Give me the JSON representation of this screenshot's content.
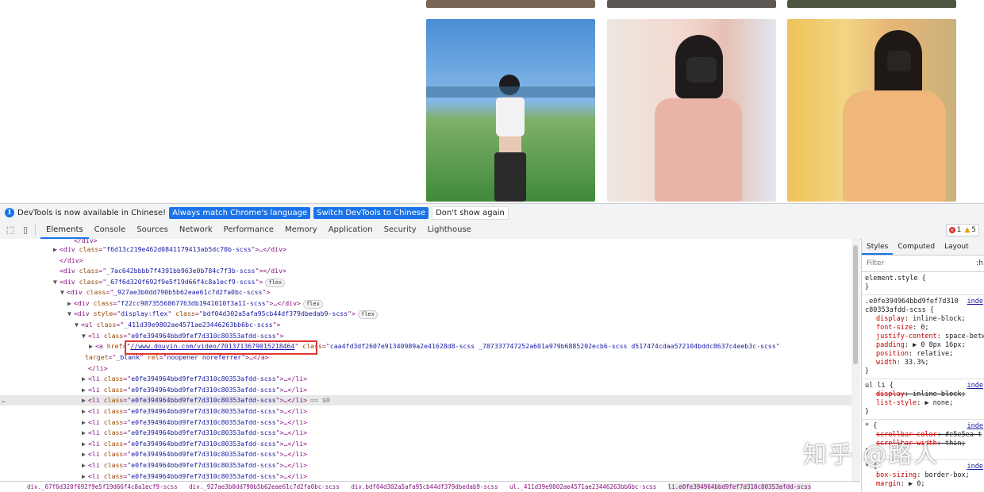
{
  "infobar": {
    "message": "DevTools is now available in Chinese!",
    "btn_match": "Always match Chrome's language",
    "btn_switch": "Switch DevTools to Chinese",
    "btn_dismiss": "Don't show again"
  },
  "tabs": [
    "Elements",
    "Console",
    "Sources",
    "Network",
    "Performance",
    "Memory",
    "Application",
    "Security",
    "Lighthouse"
  ],
  "issues": {
    "errors": "1",
    "warnings": "5"
  },
  "dom_lines": [
    {
      "indent": 0,
      "tri": "",
      "html": "</div>"
    },
    {
      "indent": 1,
      "tri": "▶",
      "tag_open": "<div ",
      "attr": "class",
      "val": "f6d13c219e462d0841179413ab5dc70b-scss",
      "tail": ">…</div>"
    },
    {
      "indent": 1,
      "tri": "",
      "tag_open": "</div>",
      "attr": "",
      "val": "",
      "tail": ""
    },
    {
      "indent": 1,
      "tri": "",
      "tag_open": "<div ",
      "attr": "class",
      "val": "_7ac642bbbb7f4391bb963e0b784c7f3b-scss",
      "tail": "></div>"
    },
    {
      "indent": 1,
      "tri": "▼",
      "tag_open": "<div ",
      "attr": "class",
      "val": "_67f6d320f692f9e5f19d66f4c8a1ecf9-scss",
      "tail": ">",
      "pill": "flex"
    },
    {
      "indent": 2,
      "tri": "▼",
      "tag_open": "<div ",
      "attr": "class",
      "val": "_927ae3b0dd790b5b62eae61c7d2fa0bc-scss",
      "tail": ">"
    },
    {
      "indent": 3,
      "tri": "▶",
      "tag_open": "<div ",
      "attr": "class",
      "val": "f22cc9873556867763db1941010f3a11-scss",
      "tail": ">…</div>",
      "pill": "flex"
    },
    {
      "indent": 3,
      "tri": "▼",
      "tag_open": "<div ",
      "attr": "style",
      "val": "display:flex",
      "attr2": "class",
      "val2": "bdf04d302a5afa95cb44df379dbedab9-scss",
      "tail": ">",
      "pill": "flex"
    },
    {
      "indent": 4,
      "tri": "▼",
      "tag_open": "<ul ",
      "attr": "class",
      "val": "_411d39e9802ae4571ae23446263bb6bc-scss",
      "tail": ">"
    },
    {
      "indent": 5,
      "tri": "▼",
      "tag_open": "<li ",
      "attr": "class",
      "val": "e0fe394964bbd9fef7d310c80353afdd-scss",
      "tail": ">"
    },
    {
      "indent": 6,
      "tri": "▶",
      "tag_open": "<a ",
      "attr": "href",
      "val": "//www.douyin.com/video/7013713679015218464",
      "attr2": "class",
      "val2": "caa4fd3df2607e91340989a2e41628d8-scss _787337747252a601a979b6885202ecb6-scss d517474cdaa572104bddc8637c4eeb3c-scss",
      "tail": "",
      "link": true
    },
    {
      "indent": 5,
      "tri": "",
      "tag_open": "",
      "attr": "target",
      "val": "_blank",
      "attr2": "rel",
      "val2": "noopener noreferrer",
      "tail": ">…</a>",
      "cont": true
    },
    {
      "indent": 5,
      "tri": "",
      "tag_open": "</li>",
      "attr": "",
      "val": "",
      "tail": ""
    },
    {
      "indent": 5,
      "tri": "▶",
      "tag_open": "<li ",
      "attr": "class",
      "val": "e0fe394964bbd9fef7d310c80353afdd-scss",
      "tail": ">…</li>"
    },
    {
      "indent": 5,
      "tri": "▶",
      "tag_open": "<li ",
      "attr": "class",
      "val": "e0fe394964bbd9fef7d310c80353afdd-scss",
      "tail": ">…</li>"
    },
    {
      "indent": 5,
      "tri": "▶",
      "tag_open": "<li ",
      "attr": "class",
      "val": "e0fe394964bbd9fef7d310c80353afdd-scss",
      "tail": ">…</li>",
      "selected": true,
      "eq": "== $0"
    },
    {
      "indent": 5,
      "tri": "▶",
      "tag_open": "<li ",
      "attr": "class",
      "val": "e0fe394964bbd9fef7d310c80353afdd-scss",
      "tail": ">…</li>"
    },
    {
      "indent": 5,
      "tri": "▶",
      "tag_open": "<li ",
      "attr": "class",
      "val": "e0fe394964bbd9fef7d310c80353afdd-scss",
      "tail": ">…</li>"
    },
    {
      "indent": 5,
      "tri": "▶",
      "tag_open": "<li ",
      "attr": "class",
      "val": "e0fe394964bbd9fef7d310c80353afdd-scss",
      "tail": ">…</li>"
    },
    {
      "indent": 5,
      "tri": "▶",
      "tag_open": "<li ",
      "attr": "class",
      "val": "e0fe394964bbd9fef7d310c80353afdd-scss",
      "tail": ">…</li>"
    },
    {
      "indent": 5,
      "tri": "▶",
      "tag_open": "<li ",
      "attr": "class",
      "val": "e0fe394964bbd9fef7d310c80353afdd-scss",
      "tail": ">…</li>"
    },
    {
      "indent": 5,
      "tri": "▶",
      "tag_open": "<li ",
      "attr": "class",
      "val": "e0fe394964bbd9fef7d310c80353afdd-scss",
      "tail": ">…</li>"
    },
    {
      "indent": 5,
      "tri": "▶",
      "tag_open": "<li ",
      "attr": "class",
      "val": "e0fe394964bbd9fef7d310c80353afdd-scss",
      "tail": ">…</li>"
    }
  ],
  "selected_marker": "…",
  "breadcrumb": [
    "div._67f6d320f692f9e5f19d66f4c8a1ecf9-scss",
    "div._927ae3b0dd790b5b62eae61c7d2fa0bc-scss",
    "div.bdf04d302a5afa95cb44df379dbedab9-scss",
    "ul._411d39e9802ae4571ae23446263bb6bc-scss",
    "li.e0fe394964bbd9fef7d310c80353afdd-scss"
  ],
  "styles_panel": {
    "tabs": [
      "Styles",
      "Computed",
      "Layout"
    ],
    "filter_placeholder": "Filter",
    "filter_hov": ":h",
    "element_style": "element.style {",
    "close": "}",
    "rule1_selector": ".e0fe394964bbd9fef7d310",
    "rule1_selector2": "c80353afdd-scss {",
    "rule1_src": "inde",
    "rule1_props": [
      {
        "p": "display",
        "v": "inline-block;"
      },
      {
        "p": "font-size",
        "v": "0;"
      },
      {
        "p": "justify-content",
        "v": "space-betw"
      },
      {
        "p": "padding",
        "v": "▶ 0 8px 16px;"
      },
      {
        "p": "position",
        "v": "relative;"
      },
      {
        "p": "width",
        "v": "33.3%;"
      }
    ],
    "rule2_selector": "ul li {",
    "rule2_src": "inde",
    "rule2_props": [
      {
        "p": "display",
        "v": "inline-block;",
        "strike": true
      },
      {
        "p": "list-style",
        "v": "▶ none;"
      }
    ],
    "rule3_selector": "* {",
    "rule3_src": "inde",
    "rule3_props": [
      {
        "p": "scrollbar-color",
        "v": "#e5e5ea t",
        "strike": true
      },
      {
        "p": "scrollbar-width",
        "v": "thin;",
        "strike": true
      }
    ],
    "rule4_selector": "* {",
    "rule4_src": "inde",
    "rule4_props": [
      {
        "p": "box-sizing",
        "v": "border-box;"
      },
      {
        "p": "margin",
        "v": "▶ 0;"
      }
    ]
  },
  "watermark": "知乎 @路人"
}
